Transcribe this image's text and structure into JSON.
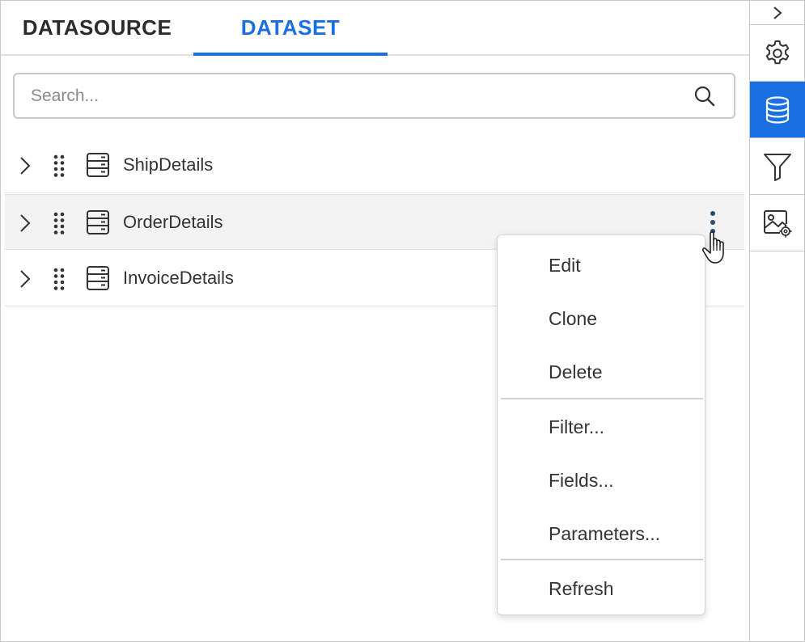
{
  "tabs": [
    {
      "label": "DATASOURCE",
      "active": false
    },
    {
      "label": "DATASET",
      "active": true
    }
  ],
  "search": {
    "placeholder": "Search...",
    "value": ""
  },
  "datasets": [
    {
      "label": "ShipDetails"
    },
    {
      "label": "OrderDetails",
      "selected": true
    },
    {
      "label": "InvoiceDetails"
    }
  ],
  "context_menu": {
    "items": [
      "Edit",
      "Clone",
      "Delete",
      "Filter...",
      "Fields...",
      "Parameters...",
      "Refresh"
    ]
  },
  "sidebar": {
    "items": [
      {
        "icon": "chevron-right-icon"
      },
      {
        "icon": "gear-icon"
      },
      {
        "icon": "database-icon",
        "active": true
      },
      {
        "icon": "filter-icon"
      },
      {
        "icon": "image-settings-icon"
      }
    ]
  },
  "colors": {
    "accent": "#1a6fe3",
    "selected_row": "#f3f3f3",
    "text": "#333333"
  }
}
